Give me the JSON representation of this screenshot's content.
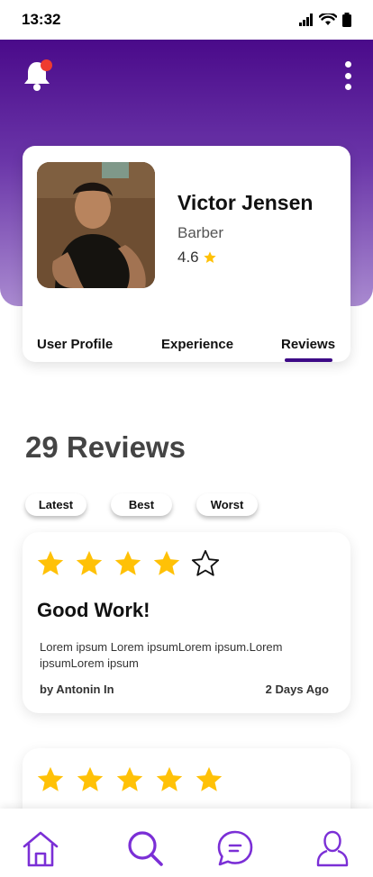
{
  "status_bar": {
    "time": "13:32"
  },
  "colors": {
    "primary": "#3d0a86",
    "header_gradient_top": "#4a0a8a",
    "star": "#ffc107",
    "notification": "#ee3b2f"
  },
  "header": {
    "icons": [
      "bell-icon",
      "kebab-menu-icon"
    ]
  },
  "profile": {
    "name": "Victor Jensen",
    "role": "Barber",
    "rating": "4.6",
    "tabs": [
      {
        "label": "User Profile",
        "active": false
      },
      {
        "label": "Experience",
        "active": false
      },
      {
        "label": "Reviews",
        "active": true
      }
    ]
  },
  "reviews": {
    "count_label": "29 Reviews",
    "filters": [
      {
        "label": "Latest"
      },
      {
        "label": "Best"
      },
      {
        "label": "Worst"
      }
    ],
    "items": [
      {
        "stars": 4,
        "title": "Good Work!",
        "body": "Lorem ipsum Lorem ipsumLorem ipsum.Lorem ipsumLorem ipsum",
        "author": "by Antonin In",
        "date": "2 Days Ago"
      },
      {
        "stars": 5
      }
    ]
  },
  "bottom_nav": {
    "items": [
      {
        "icon": "home-icon"
      },
      {
        "icon": "search-icon"
      },
      {
        "icon": "chat-icon"
      },
      {
        "icon": "profile-icon"
      }
    ]
  }
}
